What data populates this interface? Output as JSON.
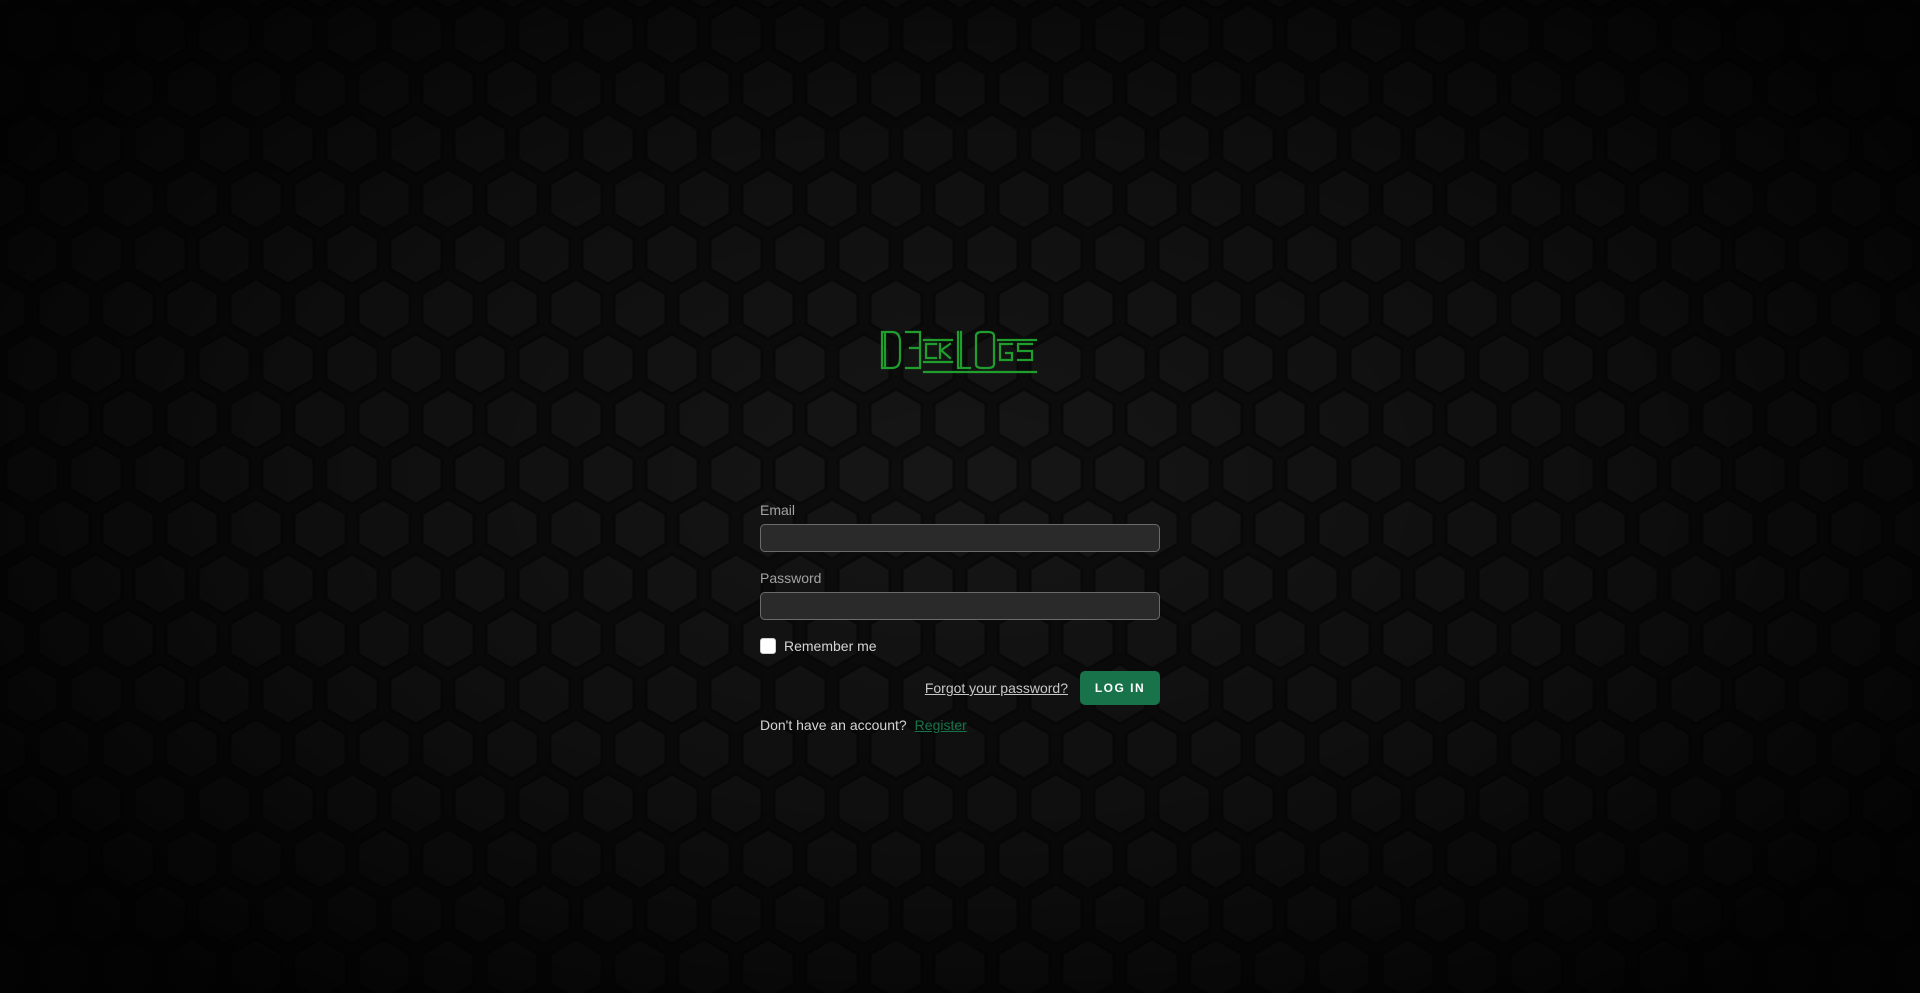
{
  "brand": {
    "logo_text": "D3CKLOGS",
    "logo_color": "#1f9e2e"
  },
  "form": {
    "email_label": "Email",
    "email_value": "",
    "password_label": "Password",
    "password_value": "",
    "remember_label": "Remember me",
    "remember_checked": false,
    "forgot_link": "Forgot your password?",
    "login_button": "LOG IN",
    "no_account_text": "Don't have an account?",
    "register_link": "Register"
  },
  "colors": {
    "background": "#0d0d0d",
    "hex_fill": "#151515",
    "accent": "#19734a"
  }
}
